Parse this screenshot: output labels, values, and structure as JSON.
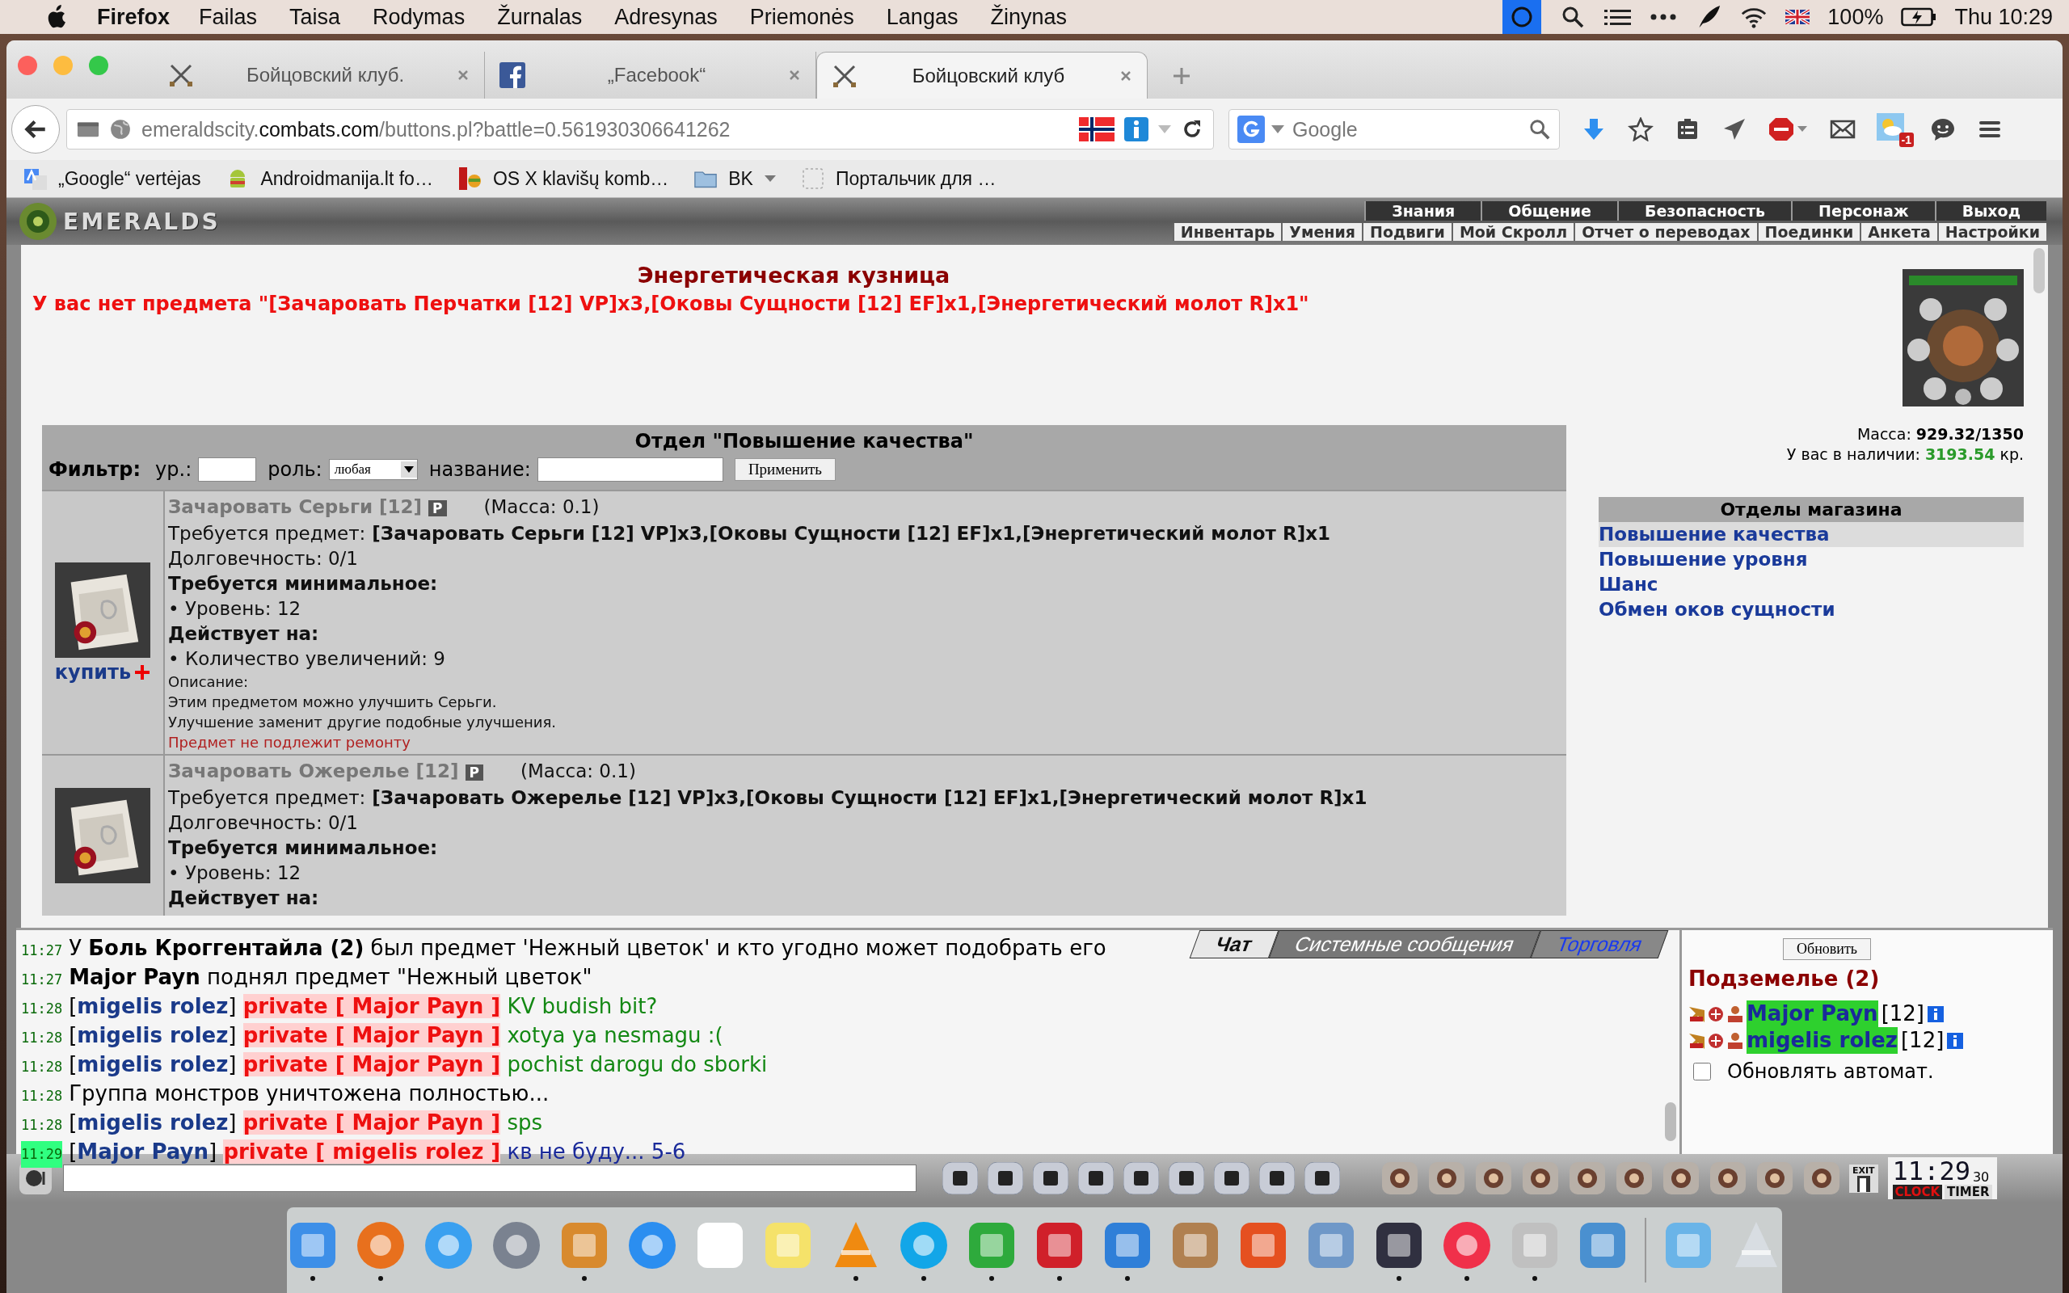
{
  "menubar": {
    "app": "Firefox",
    "items": [
      "Failas",
      "Taisa",
      "Rodymas",
      "Žurnalas",
      "Adresynas",
      "Priemonės",
      "Langas",
      "Žinynas"
    ],
    "battery": "100%",
    "clock": "Thu 10:29"
  },
  "tabs": [
    {
      "title": "Бойцовский клуб.",
      "kind": "game",
      "selected": false
    },
    {
      "title": "„Facebook“",
      "kind": "facebook",
      "selected": false
    },
    {
      "title": "Бойцовский клуб",
      "kind": "game",
      "selected": true
    }
  ],
  "address": {
    "subdomain": "emeraldscity.",
    "domain": "combats.com",
    "path": "/buttons.pl?battle=0.561930306641262"
  },
  "search": {
    "placeholder": "Google"
  },
  "weather_badge": "-1",
  "bookmarks": [
    {
      "label": "„Google“ vertėjas",
      "kind": "translate"
    },
    {
      "label": "Androidmanija.lt fo…",
      "kind": "android"
    },
    {
      "label": "OS X klavišų komb…",
      "kind": "apple"
    },
    {
      "label": "BK",
      "kind": "folder"
    },
    {
      "label": "Портальчик для …",
      "kind": "blank"
    }
  ],
  "game": {
    "logo": "EMERALDS",
    "nav_top": [
      "Знания",
      "Общение",
      "Безопасность",
      "Персонаж",
      "Выход"
    ],
    "nav_bottom": [
      "Инвентарь",
      "Умения",
      "Подвиги",
      "Мой Скролл",
      "Отчет о переводах",
      "Поединки",
      "Анкета",
      "Настройки"
    ],
    "title": "Энергетическая кузница",
    "error": "У вас нет предмета \"[Зачаровать Перчатки [12] VP]x3,[Оковы Сущности [12] EF]x1,[Энергетический молот R]x1\"",
    "department": "Отдел \"Повышение качества\"",
    "filter": {
      "label": "Фильтр:",
      "level_label": "ур.:",
      "role_label": "роль:",
      "role_value": "любая",
      "name_label": "название:",
      "apply": "Применить"
    },
    "items": [
      {
        "name": "Зачаровать Серьги [12]",
        "badge": "P",
        "mass": "(Масса: 0.1)",
        "requires_label": "Требуется предмет:",
        "requires": "[Зачаровать Серьги [12] VP]x3,[Оковы Сущности [12] EF]x1,[Энергетический молот R]x1",
        "durability": "Долговечность: 0/1",
        "min_title": "Требуется минимальное:",
        "min": [
          "• Уровень: 12"
        ],
        "effects_title": "Действует на:",
        "effects": [
          "• Количество увеличений: 9"
        ],
        "desc_title": "Описание:",
        "desc": [
          "Этим предметом можно улучшить Серьги.",
          "Улучшение заменит другие подобные улучшения."
        ],
        "no_repair": "Предмет не подлежит ремонту",
        "buy": "купить"
      },
      {
        "name": "Зачаровать Ожерелье [12]",
        "badge": "P",
        "mass": "(Масса: 0.1)",
        "requires_label": "Требуется предмет:",
        "requires": "[Зачаровать Ожерелье [12] VP]x3,[Оковы Сущности [12] EF]x1,[Энергетический молот R]x1",
        "durability": "Долговечность: 0/1",
        "min_title": "Требуется минимальное:",
        "min": [
          "• Уровень: 12"
        ],
        "effects_title": "Действует на:"
      }
    ],
    "mass_label": "Масса:",
    "mass": "929.32/1350",
    "money_label": "У вас в наличии:",
    "money": "3193.54",
    "money_unit": "кр.",
    "sections_title": "Отделы магазина",
    "sections": [
      {
        "label": "Повышение качества",
        "selected": true
      },
      {
        "label": "Повышение уровня",
        "selected": false
      },
      {
        "label": "Шанс",
        "selected": false
      },
      {
        "label": "Обмен оков сущности",
        "selected": false
      }
    ]
  },
  "chat": {
    "tabs": [
      {
        "label": "Чат",
        "kind": "plain",
        "selected": true
      },
      {
        "label": "Системные сообщения",
        "kind": "plain",
        "selected": false
      },
      {
        "label": "Торговля",
        "kind": "link",
        "selected": false
      }
    ],
    "messages": [
      {
        "time": "11:27",
        "highlight": false,
        "parts": [
          {
            "kind": "text",
            "text": "У "
          },
          {
            "kind": "bold",
            "text": "Боль Кроггентайла (2)"
          },
          {
            "kind": "text",
            "text": " был предмет 'Нежный цветок' и кто угодно может подобрать его"
          }
        ]
      },
      {
        "time": "11:27",
        "highlight": false,
        "parts": [
          {
            "kind": "bold",
            "text": "Major Payn"
          },
          {
            "kind": "text",
            "text": " поднял предмет \"Нежный цветок\""
          }
        ]
      },
      {
        "time": "11:28",
        "highlight": false,
        "parts": [
          {
            "kind": "text",
            "text": "["
          },
          {
            "kind": "nick",
            "text": "migelis rolez"
          },
          {
            "kind": "text",
            "text": "] "
          },
          {
            "kind": "private",
            "text": "private [ Major Payn ]"
          },
          {
            "kind": "said",
            "text": " KV budish bit?"
          }
        ]
      },
      {
        "time": "11:28",
        "highlight": false,
        "parts": [
          {
            "kind": "text",
            "text": "["
          },
          {
            "kind": "nick",
            "text": "migelis rolez"
          },
          {
            "kind": "text",
            "text": "] "
          },
          {
            "kind": "private",
            "text": "private [ Major Payn ]"
          },
          {
            "kind": "said",
            "text": " xotya ya nesmagu :("
          }
        ]
      },
      {
        "time": "11:28",
        "highlight": false,
        "parts": [
          {
            "kind": "text",
            "text": "["
          },
          {
            "kind": "nick",
            "text": "migelis rolez"
          },
          {
            "kind": "text",
            "text": "] "
          },
          {
            "kind": "private",
            "text": "private [ Major Payn ]"
          },
          {
            "kind": "said",
            "text": " pochist darogu do sborki"
          }
        ]
      },
      {
        "time": "11:28",
        "highlight": false,
        "parts": [
          {
            "kind": "text",
            "text": "Группа монстров уничтожена полностью..."
          }
        ]
      },
      {
        "time": "11:28",
        "highlight": false,
        "parts": [
          {
            "kind": "text",
            "text": "["
          },
          {
            "kind": "nick",
            "text": "migelis rolez"
          },
          {
            "kind": "text",
            "text": "] "
          },
          {
            "kind": "private",
            "text": "private [ Major Payn ]"
          },
          {
            "kind": "said",
            "text": " sps"
          }
        ]
      },
      {
        "time": "11:29",
        "highlight": true,
        "parts": [
          {
            "kind": "text",
            "text": "["
          },
          {
            "kind": "nick",
            "text": "Major Payn"
          },
          {
            "kind": "text",
            "text": "] "
          },
          {
            "kind": "private",
            "text": "private [ migelis rolez ]"
          },
          {
            "kind": "own",
            "text": " кв не буду... 5-6"
          }
        ]
      }
    ],
    "refresh": "Обновить",
    "location": "Подземелье (2)",
    "players": [
      {
        "name": "Major Payn",
        "level": "[12]"
      },
      {
        "name": "migelis rolez",
        "level": "[12]"
      }
    ],
    "auto_refresh": {
      "label": "Обновлять автомат.",
      "checked": false
    }
  },
  "clock": {
    "exit": "EXIT",
    "time": "11:29",
    "seconds": "30",
    "clock_label": "CLOCK",
    "timer_label": "TIMER"
  },
  "dock": [
    {
      "running": true
    },
    {
      "running": true
    },
    {
      "running": false
    },
    {
      "running": false
    },
    {
      "running": true
    },
    {
      "running": false
    },
    {
      "running": false
    },
    {
      "running": false
    },
    {
      "running": true
    },
    {
      "running": true
    },
    {
      "running": true
    },
    {
      "running": true
    },
    {
      "running": true
    },
    {
      "running": false
    },
    {
      "running": false
    },
    {
      "running": false
    },
    {
      "running": true
    },
    {
      "running": true
    },
    {
      "running": true
    },
    {
      "running": false
    },
    {
      "running": false
    },
    {
      "running": false
    }
  ]
}
